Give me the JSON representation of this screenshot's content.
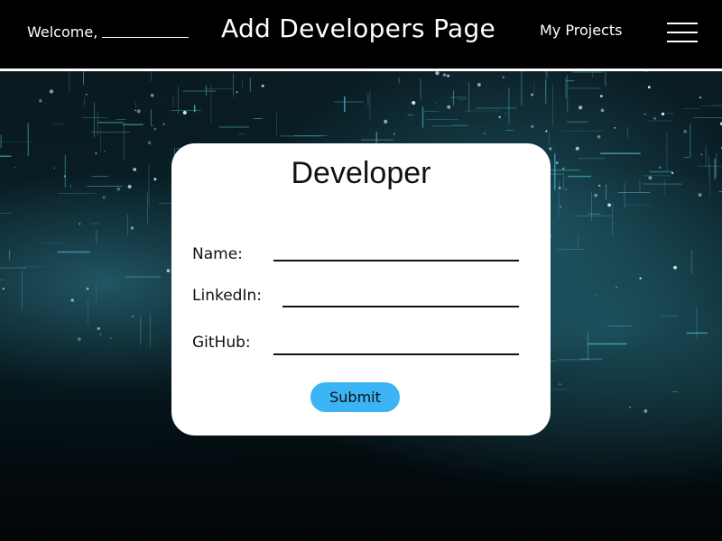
{
  "header": {
    "welcome_text": "Welcome,",
    "title": "Add Developers Page",
    "nav_link": "My Projects",
    "menu_icon": "hamburger-menu-icon"
  },
  "form": {
    "title": "Developer",
    "fields": [
      {
        "label": "Name:",
        "value": ""
      },
      {
        "label": "LinkedIn:",
        "value": ""
      },
      {
        "label": "GitHub:",
        "value": ""
      }
    ],
    "submit_label": "Submit"
  },
  "colors": {
    "header_bg": "#000000",
    "card_bg": "#ffffff",
    "submit_bg": "#3ab4f5",
    "background_accent": "#4fb3c8"
  }
}
